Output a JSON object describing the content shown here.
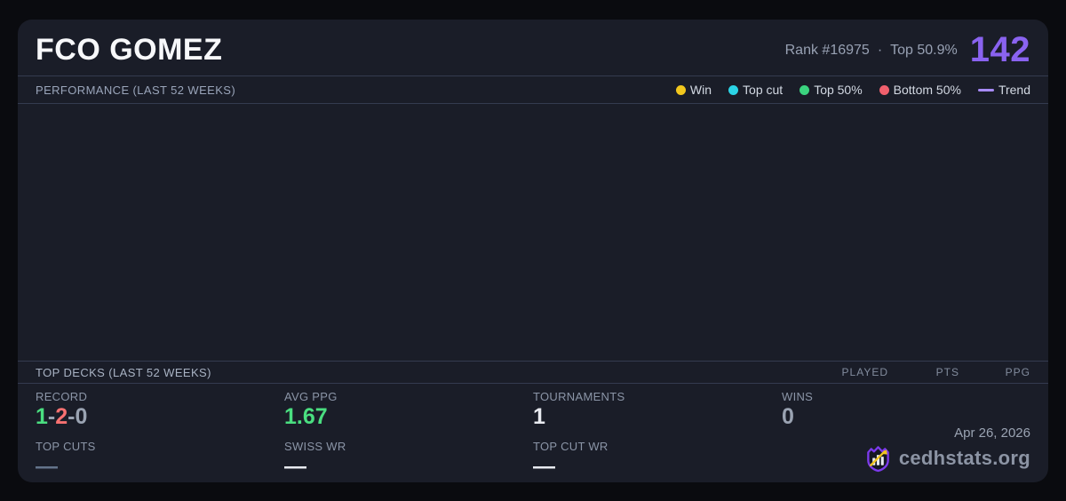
{
  "colors": {
    "accent": "#8a63f0",
    "win": "#f2c71d",
    "top_cut": "#2bd4e6",
    "top50": "#3bd47f",
    "bottom50": "#f1606d",
    "trend": "#a78bfa",
    "green": "#4ade80",
    "red": "#f87171",
    "muted": "#9aa3b2"
  },
  "header": {
    "player_name": "FCO GOMEZ",
    "rank": "Rank #16975",
    "dot_separator": "·",
    "top_percent": "Top 50.9%",
    "score": "142"
  },
  "performance": {
    "title": "PERFORMANCE (LAST 52 WEEKS)",
    "legend": [
      {
        "label": "Win"
      },
      {
        "label": "Top cut"
      },
      {
        "label": "Top 50%"
      },
      {
        "label": "Bottom 50%"
      },
      {
        "label": "Trend"
      }
    ],
    "chart": {
      "empty": true,
      "points": []
    }
  },
  "top_decks": {
    "title": "TOP DECKS (LAST 52 WEEKS)",
    "columns": [
      "PLAYED",
      "PTS",
      "PPG"
    ],
    "rows": []
  },
  "stats": {
    "record": {
      "label": "RECORD",
      "wins": "1",
      "losses": "2",
      "draws": "0",
      "separator": "-"
    },
    "avg_ppg": {
      "label": "AVG PPG",
      "value": "1.67"
    },
    "tournaments": {
      "label": "TOURNAMENTS",
      "value": "1"
    },
    "wins": {
      "label": "WINS",
      "value": "0"
    },
    "top_cuts": {
      "label": "TOP CUTS",
      "value": "—"
    },
    "swiss_wr": {
      "label": "SWISS WR",
      "value": "—"
    },
    "top_cut_wr": {
      "label": "TOP CUT WR",
      "value": "—"
    }
  },
  "footer": {
    "date": "Apr 26, 2026",
    "brand": "cedhstats.org"
  }
}
